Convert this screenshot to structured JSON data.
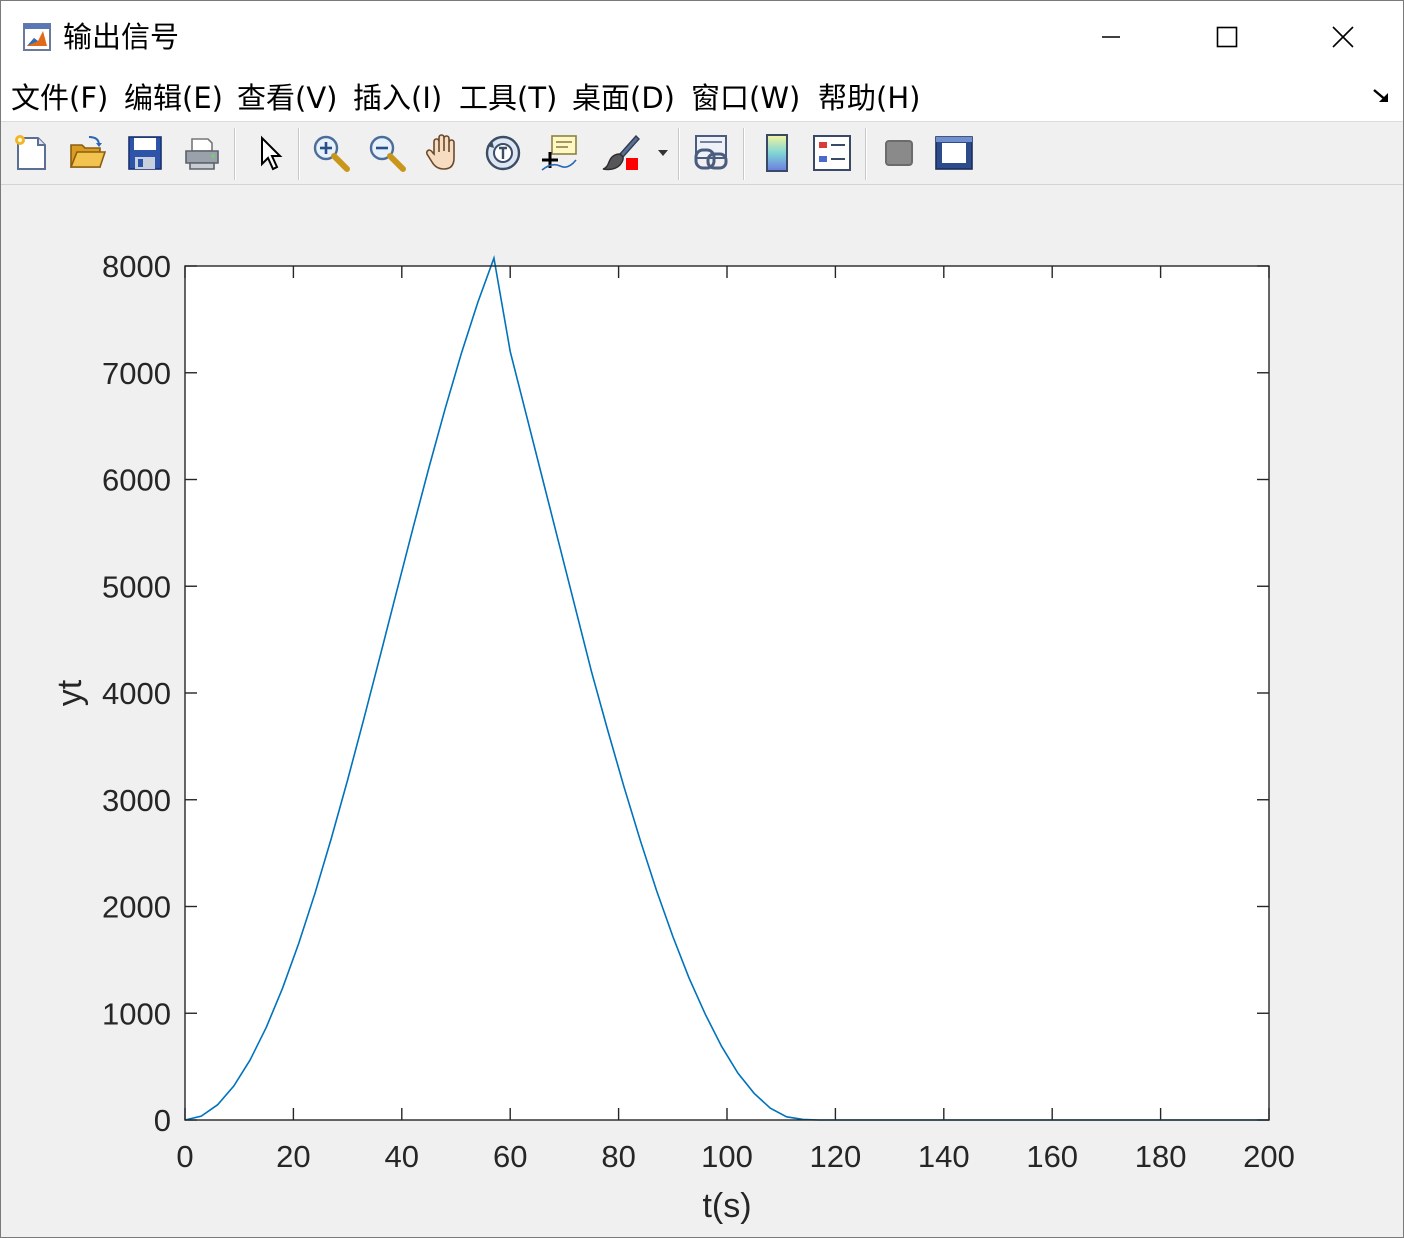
{
  "window": {
    "title": "输出信号",
    "icon": "matlab-figure-icon"
  },
  "menubar": {
    "items": [
      {
        "label": "文件(F)",
        "name": "menu-file"
      },
      {
        "label": "编辑(E)",
        "name": "menu-edit"
      },
      {
        "label": "查看(V)",
        "name": "menu-view"
      },
      {
        "label": "插入(I)",
        "name": "menu-insert"
      },
      {
        "label": "工具(T)",
        "name": "menu-tools"
      },
      {
        "label": "桌面(D)",
        "name": "menu-desktop"
      },
      {
        "label": "窗口(W)",
        "name": "menu-window"
      },
      {
        "label": "帮助(H)",
        "name": "menu-help"
      }
    ]
  },
  "toolbar": {
    "icons": [
      "new-figure-icon",
      "open-file-icon",
      "save-icon",
      "print-icon",
      "pointer-icon",
      "zoom-in-icon",
      "zoom-out-icon",
      "pan-hand-icon",
      "rotate-3d-icon",
      "data-cursor-icon",
      "brush-icon",
      "link-plot-icon",
      "colorbar-icon",
      "legend-icon",
      "hide-plot-tools-icon",
      "show-plot-tools-icon"
    ]
  },
  "colors": {
    "line": "#0072BD",
    "axes_bg": "#ffffff",
    "figure_bg": "#f0f0f0"
  },
  "chart_data": {
    "type": "line",
    "xlabel": "t(s)",
    "ylabel": "yt",
    "xlim": [
      0,
      200
    ],
    "ylim": [
      0,
      8000
    ],
    "xticks": [
      0,
      20,
      40,
      60,
      80,
      100,
      120,
      140,
      160,
      180,
      200
    ],
    "yticks": [
      0,
      1000,
      2000,
      3000,
      4000,
      5000,
      6000,
      7000,
      8000
    ],
    "grid": false,
    "series": [
      {
        "x": [
          0,
          3,
          6,
          9,
          12,
          15,
          18,
          21,
          24,
          27,
          30,
          33,
          36,
          39,
          42,
          45,
          48,
          51,
          54,
          57,
          60,
          63,
          66,
          69,
          72,
          75,
          78,
          81,
          84,
          87,
          90,
          93,
          96,
          99,
          102,
          105,
          108,
          111,
          114,
          117,
          120,
          140,
          160,
          180,
          200
        ],
        "y": [
          0,
          36,
          142,
          318,
          561,
          868,
          1235,
          1657,
          2127,
          2639,
          3185,
          3758,
          4346,
          4941,
          5532,
          6110,
          6663,
          7183,
          7656,
          8074,
          7200,
          6600,
          6000,
          5400,
          4800,
          4200,
          3650,
          3120,
          2620,
          2150,
          1720,
          1330,
          990,
          690,
          440,
          250,
          110,
          30,
          5,
          0,
          0,
          0,
          0,
          0,
          0
        ]
      }
    ]
  }
}
